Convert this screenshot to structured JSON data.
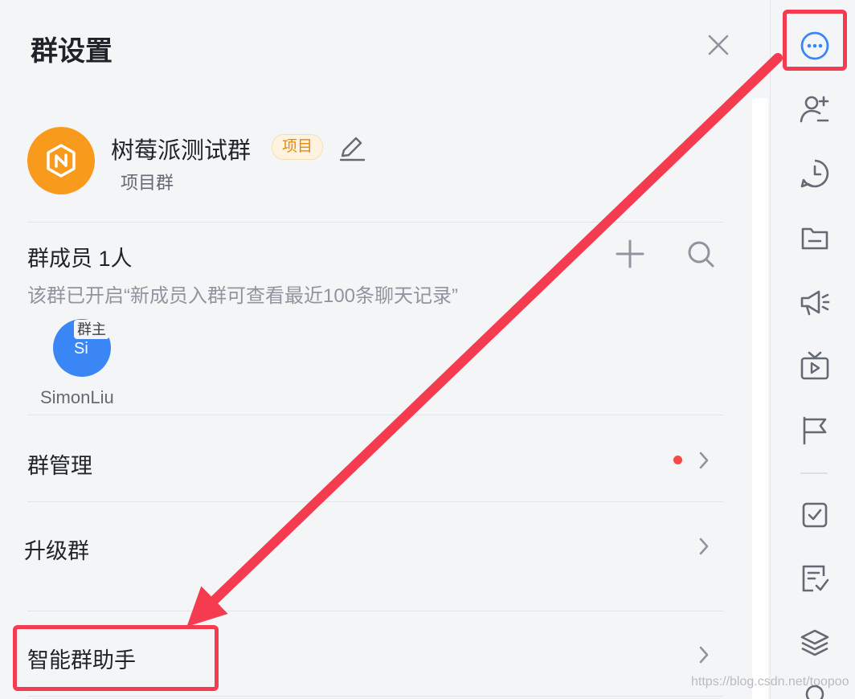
{
  "header": {
    "title": "群设置"
  },
  "group": {
    "name": "树莓派测试群",
    "badge": "项目",
    "type": "项目群"
  },
  "members": {
    "title": "群成员 1人",
    "hint": "该群已开启“新成员入群可查看最近100条聊天记录”",
    "list": [
      {
        "initials": "Si",
        "role": "群主",
        "name": "SimonLiu"
      }
    ]
  },
  "rows": [
    {
      "label": "群管理",
      "has_notification": true
    },
    {
      "label": "升级群",
      "has_notification": false
    },
    {
      "label": "智能群助手",
      "has_notification": false
    }
  ],
  "sidebar": {
    "icons": [
      "more-icon",
      "add-user-icon",
      "history-icon",
      "folder-icon",
      "announcement-icon",
      "live-icon",
      "flag-icon",
      "task-icon",
      "note-icon",
      "layers-icon"
    ]
  },
  "annotation": {
    "color": "#f53b4f"
  },
  "colors": {
    "accent": "#3a86f4",
    "group_avatar": "#f89b1c",
    "badge_text": "#e88a06",
    "notification": "#f54a45"
  },
  "watermark": "https://blog.csdn.net/toopoo"
}
